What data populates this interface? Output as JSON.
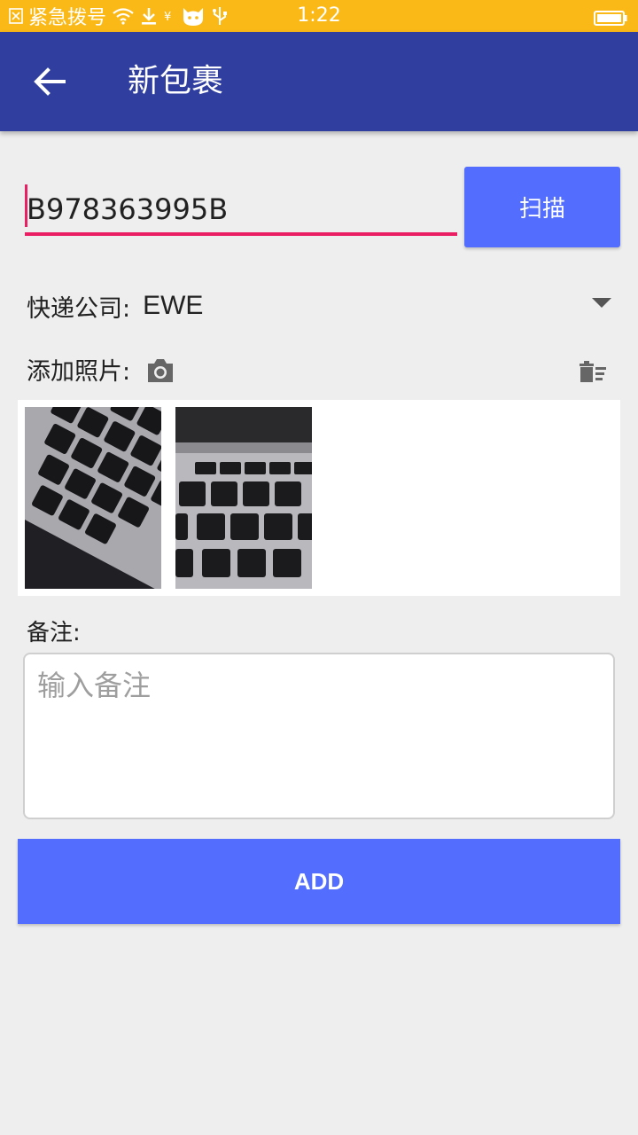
{
  "status_bar": {
    "carrier_text": "紧急拨号",
    "time": "1:22",
    "icons": [
      "sim-absent-icon",
      "wifi-icon",
      "download-icon",
      "notification-icon",
      "cat-app-icon",
      "usb-icon",
      "battery-icon"
    ]
  },
  "app_bar": {
    "title": "新包裹",
    "back_icon": "arrow-back-icon",
    "background": "#303f9f"
  },
  "form": {
    "tracking_number": "B978363995B",
    "scan_label": "扫描",
    "courier_label": "快递公司:",
    "courier_value": "EWE",
    "photo_label": "添加照片:",
    "photos": [
      {
        "name": "keyboard-photo-1"
      },
      {
        "name": "keyboard-photo-2"
      }
    ],
    "remark_label": "备注:",
    "remark_placeholder": "输入备注",
    "add_label": "ADD"
  },
  "colors": {
    "accent": "#536dfe",
    "status_bar": "#fbb917",
    "input_underline": "#e91e63",
    "background": "#eeeeee"
  }
}
